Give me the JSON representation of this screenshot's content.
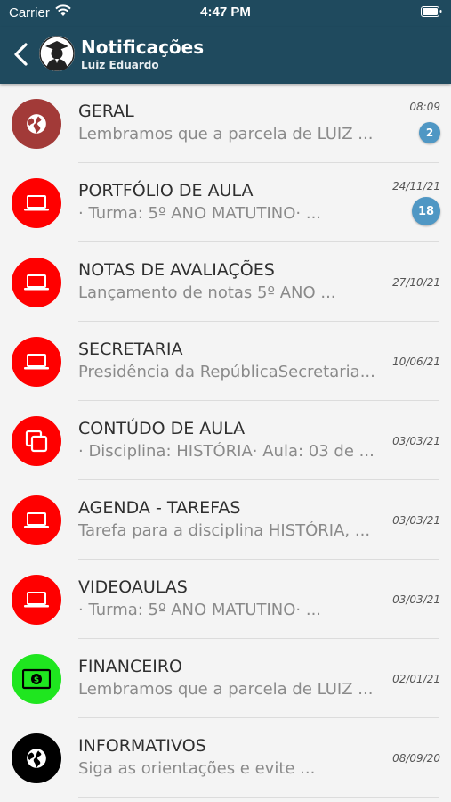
{
  "status_bar": {
    "carrier": "Carrier",
    "time": "4:47 PM"
  },
  "header": {
    "title": "Notificações",
    "subtitle": "Luiz Eduardo"
  },
  "colors": {
    "header": "#1f4a5e",
    "badge": "#4f97c4",
    "red": "#ff0000",
    "dark_red": "#a23a38",
    "green": "#1fe61f",
    "black": "#000000"
  },
  "notifications": [
    {
      "title": "GERAL",
      "preview": "Lembramos que a parcela de LUIZ ...",
      "date": "08:09",
      "badge": "2",
      "icon": "globe-icon"
    },
    {
      "title": "PORTFÓLIO DE AULA",
      "preview": "· Turma: 5º ANO MATUTINO· ...",
      "date": "24/11/21",
      "badge": "18",
      "icon": "laptop-icon"
    },
    {
      "title": "NOTAS DE AVALIAÇÕES",
      "preview": "Lançamento de notas 5º ANO ...",
      "date": "27/10/21",
      "badge": "",
      "icon": "laptop-icon"
    },
    {
      "title": "SECRETARIA",
      "preview": "Presidência da RepúblicaSecretaria...",
      "date": "10/06/21",
      "badge": "",
      "icon": "laptop-icon"
    },
    {
      "title": "CONTÚDO DE AULA",
      "preview": "· Disciplina: HISTÓRIA· Aula: 03 de ...",
      "date": "03/03/21",
      "badge": "",
      "icon": "copy-icon"
    },
    {
      "title": "AGENDA - TAREFAS",
      "preview": "Tarefa para a disciplina HISTÓRIA, ...",
      "date": "03/03/21",
      "badge": "",
      "icon": "laptop-icon"
    },
    {
      "title": "VIDEOAULAS",
      "preview": "· Turma: 5º ANO MATUTINO· ...",
      "date": "03/03/21",
      "badge": "",
      "icon": "laptop-icon"
    },
    {
      "title": "FINANCEIRO",
      "preview": "Lembramos que a parcela de LUIZ ...",
      "date": "02/01/21",
      "badge": "",
      "icon": "money-icon"
    },
    {
      "title": "INFORMATIVOS",
      "preview": "Siga as orientações e evite ...",
      "date": "08/09/20",
      "badge": "",
      "icon": "globe-icon"
    }
  ]
}
